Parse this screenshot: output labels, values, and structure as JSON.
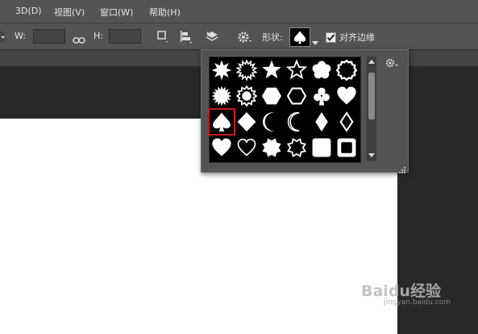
{
  "menu": [
    {
      "label": "3D(D)",
      "id": "3d"
    },
    {
      "label": "视图(V)",
      "id": "view"
    },
    {
      "label": "窗口(W)",
      "id": "window"
    },
    {
      "label": "帮助(H)",
      "id": "help"
    }
  ],
  "options": {
    "w_label": "W:",
    "h_label": "H:",
    "w_value": "",
    "h_value": "",
    "shape_label": "形状:",
    "align_label": "对齐边缘",
    "align_checked": true,
    "selected_shape": "spade"
  },
  "shapes": [
    "starburst-8",
    "starburst-16",
    "star-5",
    "star-5-outline",
    "flower",
    "scallop-outline",
    "starburst-12",
    "seal",
    "hexagon",
    "hexagon-outline",
    "club",
    "heart",
    "spade",
    "diamond",
    "moon",
    "moon-outline",
    "rhombus",
    "rhombus-outline",
    "heart-filled",
    "heart-outline",
    "star-8",
    "star-8-outline",
    "square-rounded",
    "square-frame"
  ],
  "selected_index": 12,
  "watermark": {
    "text": "Baidu经验",
    "sub": "jingyan.baidu.com"
  },
  "colors": {
    "accent": "#c41a1a",
    "panel": "#535353",
    "workspace": "#282828"
  }
}
